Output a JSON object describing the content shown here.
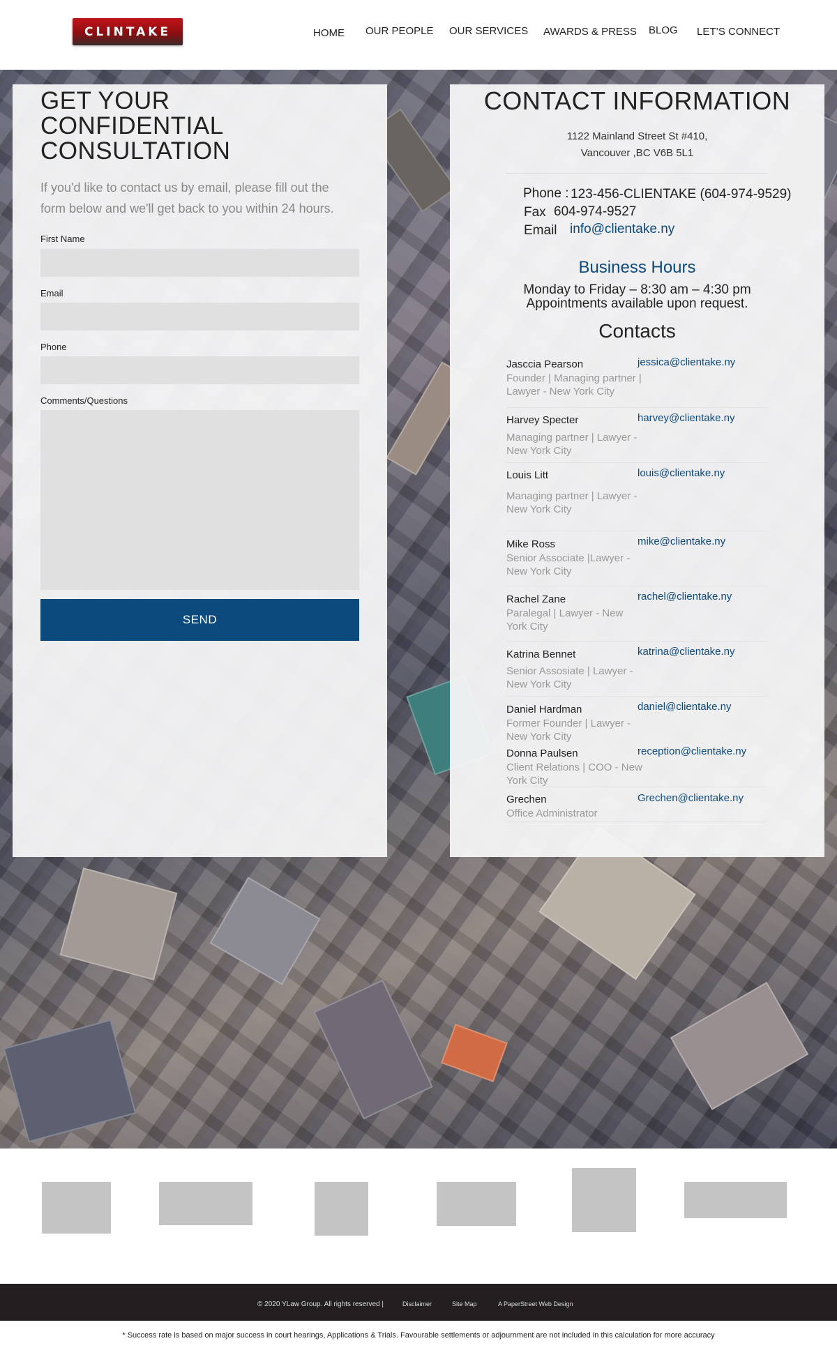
{
  "header": {
    "logo_text": "CLINTAKE",
    "nav": [
      "HOME",
      "OUR PEOPLE",
      "OUR SERVICES",
      "AWARDS & PRESS",
      "BLOG",
      "LET’S CONNECT"
    ]
  },
  "form": {
    "title_line1": "GET YOUR",
    "title_line2": "CONFIDENTIAL",
    "title_line3": "CONSULTATION",
    "intro": "If you'd like to contact us by email, please fill out the form below and we'll get back to you within 24 hours.",
    "fields": {
      "first_name_label": "First Name",
      "email_label": "Email",
      "phone_label": "Phone",
      "comments_label": "Comments/Questions"
    },
    "send_label": "SEND"
  },
  "contact_info": {
    "title": "CONTACT INFORMATION",
    "address_line1": "1122 Mainland Street St #410,",
    "address_line2": "Vancouver ,BC V6B 5L1",
    "phone_label": "Phone :",
    "phone_value": "123-456-CLIENTAKE (604-974-9529)",
    "fax_label": "Fax",
    "fax_value": "604-974-9527",
    "email_label": "Email",
    "email_value": "info@clientake.ny"
  },
  "business_hours": {
    "title": "Business Hours",
    "line1": "Monday to Friday – 8:30 am – 4:30 pm",
    "line2": "Appointments available upon request."
  },
  "contacts": {
    "title": "Contacts",
    "people": [
      {
        "name": "Jasccia Pearson",
        "role": "Founder | Managing partner | Lawyer - New York City",
        "email": "jessica@clientake.ny"
      },
      {
        "name": "Harvey Specter",
        "role": "Managing partner | Lawyer - New York City",
        "email": "harvey@clientake.ny"
      },
      {
        "name": "Louis Litt",
        "role": "Managing partner | Lawyer - New York City",
        "email": "louis@clientake.ny"
      },
      {
        "name": "Mike Ross",
        "role": "Senior Associate |Lawyer - New York City",
        "email": "mike@clientake.ny"
      },
      {
        "name": "Rachel Zane",
        "role": "Paralegal | Lawyer - New York City",
        "email": "rachel@clientake.ny"
      },
      {
        "name": "Katrina Bennet",
        "role": "Senior Assosiate | Lawyer - New York City",
        "email": "katrina@clientake.ny"
      },
      {
        "name": "Daniel Hardman",
        "role": "Former Founder | Lawyer - New York City",
        "email": "daniel@clientake.ny"
      },
      {
        "name": "Donna Paulsen",
        "role": "Client Relations | COO - New York City",
        "email": "reception@clientake.ny"
      },
      {
        "name": "Grechen",
        "role": "Office Administrator",
        "email": "Grechen@clientake.ny"
      }
    ]
  },
  "footer": {
    "copyright": "© 2020 YLaw Group. All rights reserved |",
    "disclaimer_link": "Disclaimer",
    "sitemap_link": "Site Map",
    "credit_link": "A PaperStreet Web Design"
  },
  "disclaimer_note": "* Success rate is based on major success in court hearings, Applications & Trials. Favourable settlements or adjournment are not included in this calculation for more accuracy",
  "colors": {
    "accent_blue": "#0c497c",
    "logo_red": "#c0141a",
    "footer_bg": "#231f20",
    "field_bg": "#e0e0e0"
  }
}
